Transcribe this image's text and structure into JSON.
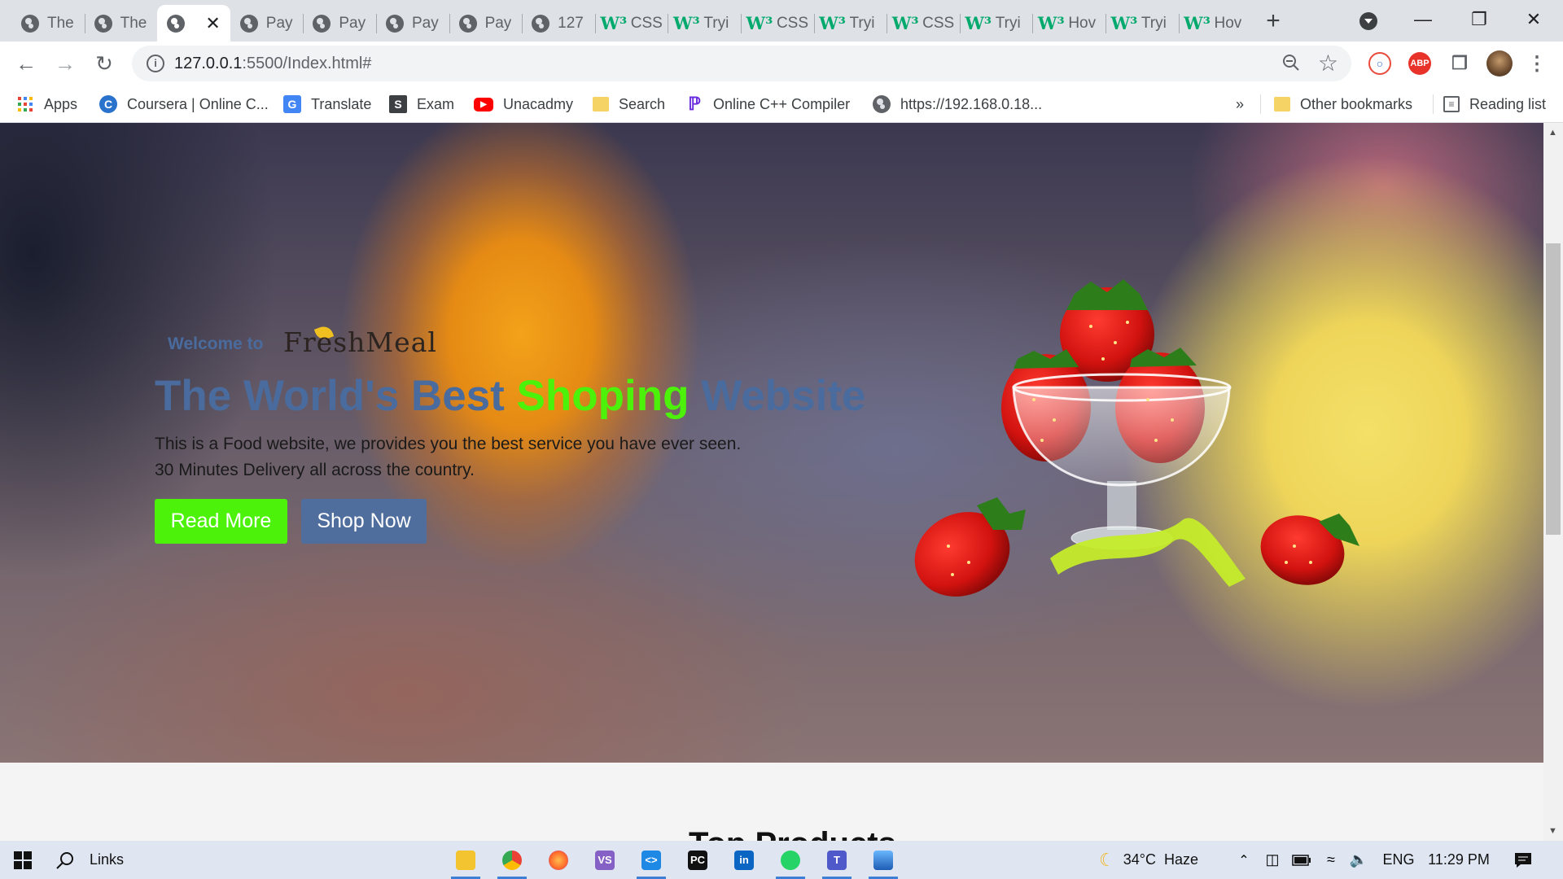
{
  "browser": {
    "tabs": [
      {
        "title": "The",
        "icon": "globe-icon",
        "active": false
      },
      {
        "title": "The",
        "icon": "globe-icon",
        "active": false
      },
      {
        "title": "",
        "icon": "globe-icon",
        "active": true
      },
      {
        "title": "Pay",
        "icon": "globe-icon",
        "active": false
      },
      {
        "title": "Pay",
        "icon": "globe-icon",
        "active": false
      },
      {
        "title": "Pay",
        "icon": "globe-icon",
        "active": false
      },
      {
        "title": "Pay",
        "icon": "globe-icon",
        "active": false
      },
      {
        "title": "127",
        "icon": "globe-icon",
        "active": false
      },
      {
        "title": "CSS",
        "icon": "w3schools-icon",
        "active": false
      },
      {
        "title": "Tryi",
        "icon": "w3schools-icon",
        "active": false
      },
      {
        "title": "CSS",
        "icon": "w3schools-icon",
        "active": false
      },
      {
        "title": "Tryi",
        "icon": "w3schools-icon",
        "active": false
      },
      {
        "title": "CSS",
        "icon": "w3schools-icon",
        "active": false
      },
      {
        "title": "Tryi",
        "icon": "w3schools-icon",
        "active": false
      },
      {
        "title": "Hov",
        "icon": "w3schools-icon",
        "active": false
      },
      {
        "title": "Tryi",
        "icon": "w3schools-icon",
        "active": false
      },
      {
        "title": "Hov",
        "icon": "w3schools-icon",
        "active": false
      }
    ],
    "w3_glyph": "W³",
    "url": {
      "host": "127.0.0.1",
      "rest": ":5500/Index.html#"
    },
    "bookmarks": [
      {
        "label": "Apps",
        "icon": "apps-grid-icon"
      },
      {
        "label": "Coursera | Online C...",
        "icon": "coursera-icon"
      },
      {
        "label": "Translate",
        "icon": "translate-icon"
      },
      {
        "label": "Exam",
        "icon": "exam-icon"
      },
      {
        "label": "Unacadmy",
        "icon": "youtube-icon"
      },
      {
        "label": "Search",
        "icon": "folder-icon"
      },
      {
        "label": "Online C++ Compiler",
        "icon": "compiler-icon"
      },
      {
        "label": "https://192.168.0.18...",
        "icon": "globe-icon"
      }
    ],
    "more_bookmarks": "»",
    "other_bookmarks": "Other bookmarks",
    "reading_list": "Reading list",
    "extensions": {
      "abp": "ABP"
    }
  },
  "page": {
    "welcome": "Welcome to",
    "brand": "FreshMeal",
    "title_part1": "The World's Best ",
    "title_part2": "Shoping",
    "title_part3": " Website",
    "description": "This is a Food website, we provides you the best service you have ever seen. 30 Minutes Delivery all across the country.",
    "read_more": "Read More",
    "shop_now": "Shop Now",
    "section_heading": "Top Products",
    "colors": {
      "accent_green": "#4cf20a",
      "accent_blue": "#4a6b9d",
      "shop_button": "#4f6e9e"
    }
  },
  "taskbar": {
    "search_label": "Links",
    "apps": [
      "file-explorer-icon",
      "chrome-icon",
      "firefox-icon",
      "visual-studio-icon",
      "vscode-icon",
      "pycharm-icon",
      "linkedin-icon",
      "whatsapp-icon",
      "teams-icon",
      "photos-icon"
    ],
    "weather_temp": "34°C",
    "weather_desc": "Haze",
    "language": "ENG",
    "time": "11:29 PM"
  }
}
